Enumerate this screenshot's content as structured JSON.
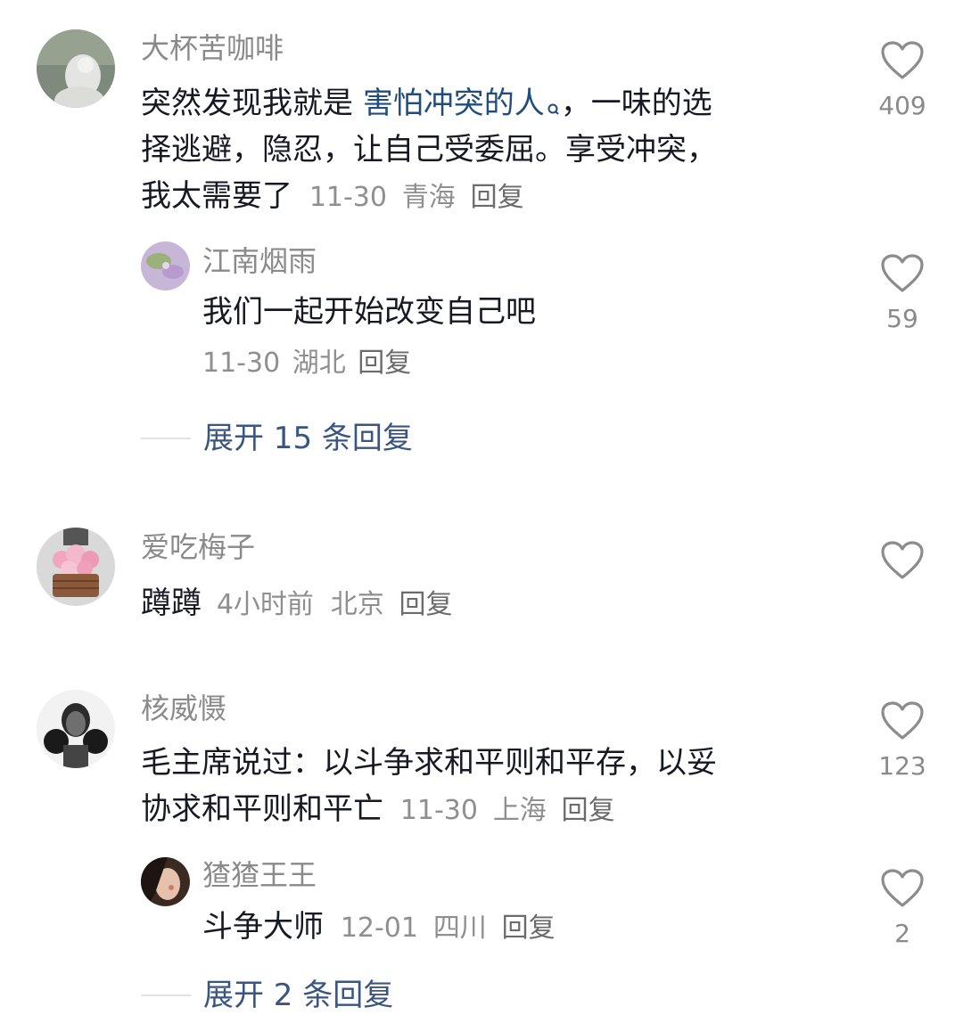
{
  "comments": [
    {
      "username": "大杯苦咖啡",
      "text_line1_pre": "突然发现我就是 ",
      "text_line1_link": "害怕冲突的人",
      "text_line1_post": "，一味的选",
      "text_line2": "择逃避，隐忍，让自己受委屈。享受冲突，",
      "text_line3": "我太需要了",
      "time": "11-30",
      "location": "青海",
      "reply_label": "回复",
      "likes": "409",
      "replies": [
        {
          "username": "江南烟雨",
          "text": "我们一起开始改变自己吧",
          "time": "11-30",
          "location": "湖北",
          "reply_label": "回复",
          "likes": "59"
        }
      ],
      "expand_label": "展开 15 条回复"
    },
    {
      "username": "爱吃梅子",
      "text": "蹲蹲",
      "time": "4小时前",
      "location": "北京",
      "reply_label": "回复",
      "likes": ""
    },
    {
      "username": "核威慑",
      "text_line1": "毛主席说过：以斗争求和平则和平存，以妥",
      "text_line2": "协求和平则和平亡",
      "time": "11-30",
      "location": "上海",
      "reply_label": "回复",
      "likes": "123",
      "replies": [
        {
          "username": "猹猹王王",
          "text": "斗争大师",
          "time": "12-01",
          "location": "四川",
          "reply_label": "回复",
          "likes": "2"
        }
      ],
      "expand_label": "展开 2 条回复"
    }
  ],
  "icons": {
    "like": "heart-outline-icon",
    "search": "search-icon"
  },
  "colors": {
    "link": "#1f4d7e",
    "expand": "#3a5680",
    "meta": "#8f8f8f"
  }
}
